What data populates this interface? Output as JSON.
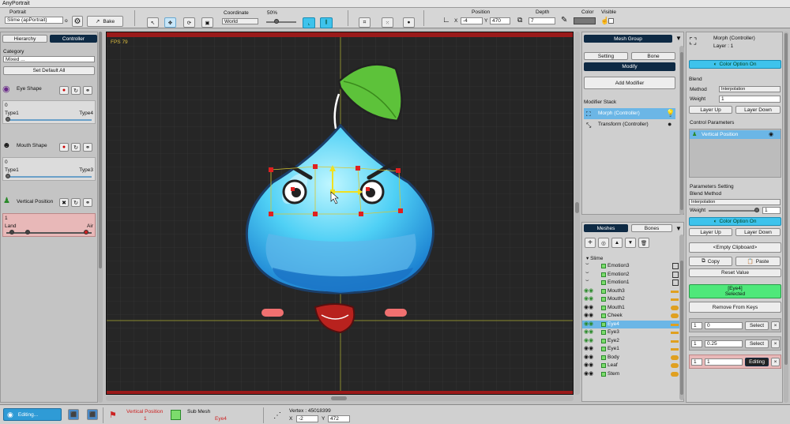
{
  "app": {
    "title": "AnyPortrait"
  },
  "toolbar": {
    "portrait_label": "Portrait",
    "portrait_value": "Slime (apPortrait)",
    "bake_label": "Bake",
    "coordinate_label": "Coordinate",
    "coordinate_value": "World",
    "zoom_label": "50%",
    "position_label": "Position",
    "pos_x_label": "X",
    "pos_x": "-4",
    "pos_y_label": "Y",
    "pos_y": "470",
    "depth_label": "Depth",
    "depth_value": "7",
    "color_label": "Color",
    "visible_label": "Visible"
  },
  "left": {
    "tab_hierarchy": "Hierarchy",
    "tab_controller": "Controller",
    "category_label": "Category",
    "category_value": "Mixed ...",
    "set_default_all": "Set Default All",
    "controllers": [
      {
        "name": "Eye Shape",
        "value": "0",
        "min_label": "Type1",
        "max_label": "Type4"
      },
      {
        "name": "Mouth Shape",
        "value": "0",
        "min_label": "Type1",
        "max_label": "Type3"
      },
      {
        "name": "Vertical Position",
        "value": "1",
        "min_label": "Land",
        "max_label": "Air"
      }
    ]
  },
  "viewport": {
    "fps": "FPS 79"
  },
  "mesh_group": {
    "header": "Mesh Group",
    "tab_setting": "Setting",
    "tab_bone": "Bone",
    "tab_modify": "Modify",
    "add_modifier": "Add Modifier",
    "stack_label": "Modifier Stack",
    "modifiers": [
      "Morph (Controller)",
      "Transform (Controller)"
    ]
  },
  "meshes": {
    "tab_meshes": "Meshes",
    "tab_bones": "Bones",
    "root": "Slime",
    "items": [
      "Emotion3",
      "Emotion2",
      "Emotion1",
      "Mouth3",
      "Mouth2",
      "Mouth1",
      "Cheek",
      "Eye4",
      "Eye3",
      "Eye2",
      "Eye1",
      "Body",
      "Leaf",
      "Stem"
    ]
  },
  "right": {
    "title": "Morph (Controller)",
    "layer": "Layer : 1",
    "color_option": "Color Option On",
    "blend_label": "Blend",
    "method_label": "Method",
    "method_value": "Interpolation",
    "weight_label": "Weight",
    "weight_value": "1",
    "layer_up": "Layer Up",
    "layer_down": "Layer Down",
    "control_params_label": "Control Parameters",
    "control_param_item": "Vertical Position",
    "params_setting_label": "Parameters Setting",
    "blend_method_label": "Blend Method",
    "blend_method_value": "Interpolation",
    "weight2_label": "Weight",
    "weight2_value": "1",
    "color_option2": "Color Option On",
    "layer_up2": "Layer Up",
    "layer_down2": "Layer Down",
    "empty_clipboard": "<Empty Clipboard>",
    "copy": "Copy",
    "paste": "Paste",
    "reset_value": "Reset Value",
    "selected_name": "[Eye4]",
    "selected_state": "Selected",
    "remove_from_keys": "Remove From Keys",
    "keys": [
      {
        "index": "1",
        "value": "0",
        "action": "Select"
      },
      {
        "index": "1",
        "value": "0.25",
        "action": "Select"
      },
      {
        "index": "1",
        "value": "1",
        "action": "Editing"
      }
    ]
  },
  "status": {
    "editing": "Editing...",
    "param_label": "Vertical Position",
    "param_value": "1",
    "submesh_label": "Sub Mesh",
    "submesh_value": "Eye4",
    "vertex_label": "Vertex : 45018399",
    "vx_label": "X",
    "vx": "-2",
    "vy_label": "Y",
    "vy": "472"
  }
}
